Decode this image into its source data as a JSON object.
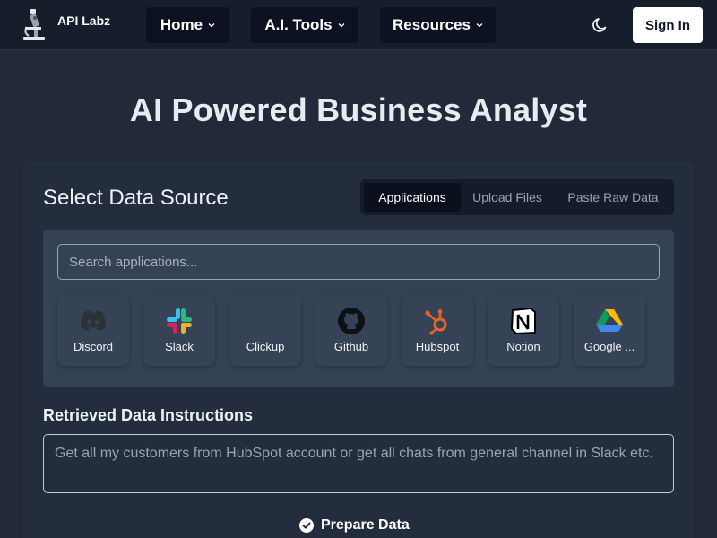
{
  "header": {
    "brand": "API Labz",
    "nav": [
      {
        "label": "Home"
      },
      {
        "label": "A.I. Tools"
      },
      {
        "label": "Resources"
      }
    ],
    "signin_label": "Sign In"
  },
  "page_title": "AI Powered Business Analyst",
  "data_source": {
    "title": "Select Data Source",
    "tabs": [
      {
        "label": "Applications",
        "active": true
      },
      {
        "label": "Upload Files",
        "active": false
      },
      {
        "label": "Paste Raw Data",
        "active": false
      }
    ],
    "search": {
      "placeholder": "Search applications...",
      "value": ""
    },
    "apps": [
      {
        "label": "Discord",
        "icon": "discord-icon"
      },
      {
        "label": "Slack",
        "icon": "slack-icon"
      },
      {
        "label": "Clickup",
        "icon": "clickup-icon"
      },
      {
        "label": "Github",
        "icon": "github-icon"
      },
      {
        "label": "Hubspot",
        "icon": "hubspot-icon"
      },
      {
        "label": "Notion",
        "icon": "notion-icon"
      },
      {
        "label": "Google ...",
        "icon": "google-drive-icon"
      }
    ]
  },
  "instructions": {
    "title": "Retrieved Data Instructions",
    "placeholder": "Get all my customers from HubSpot account or get all chats from general channel in Slack etc."
  },
  "prepare_label": "Prepare Data",
  "colors": {
    "background": "#222a39",
    "header": "#161d2b",
    "card": "#242d3d",
    "panel": "#354155",
    "hubspot": "#e8642c",
    "discord": "#2b3038"
  }
}
